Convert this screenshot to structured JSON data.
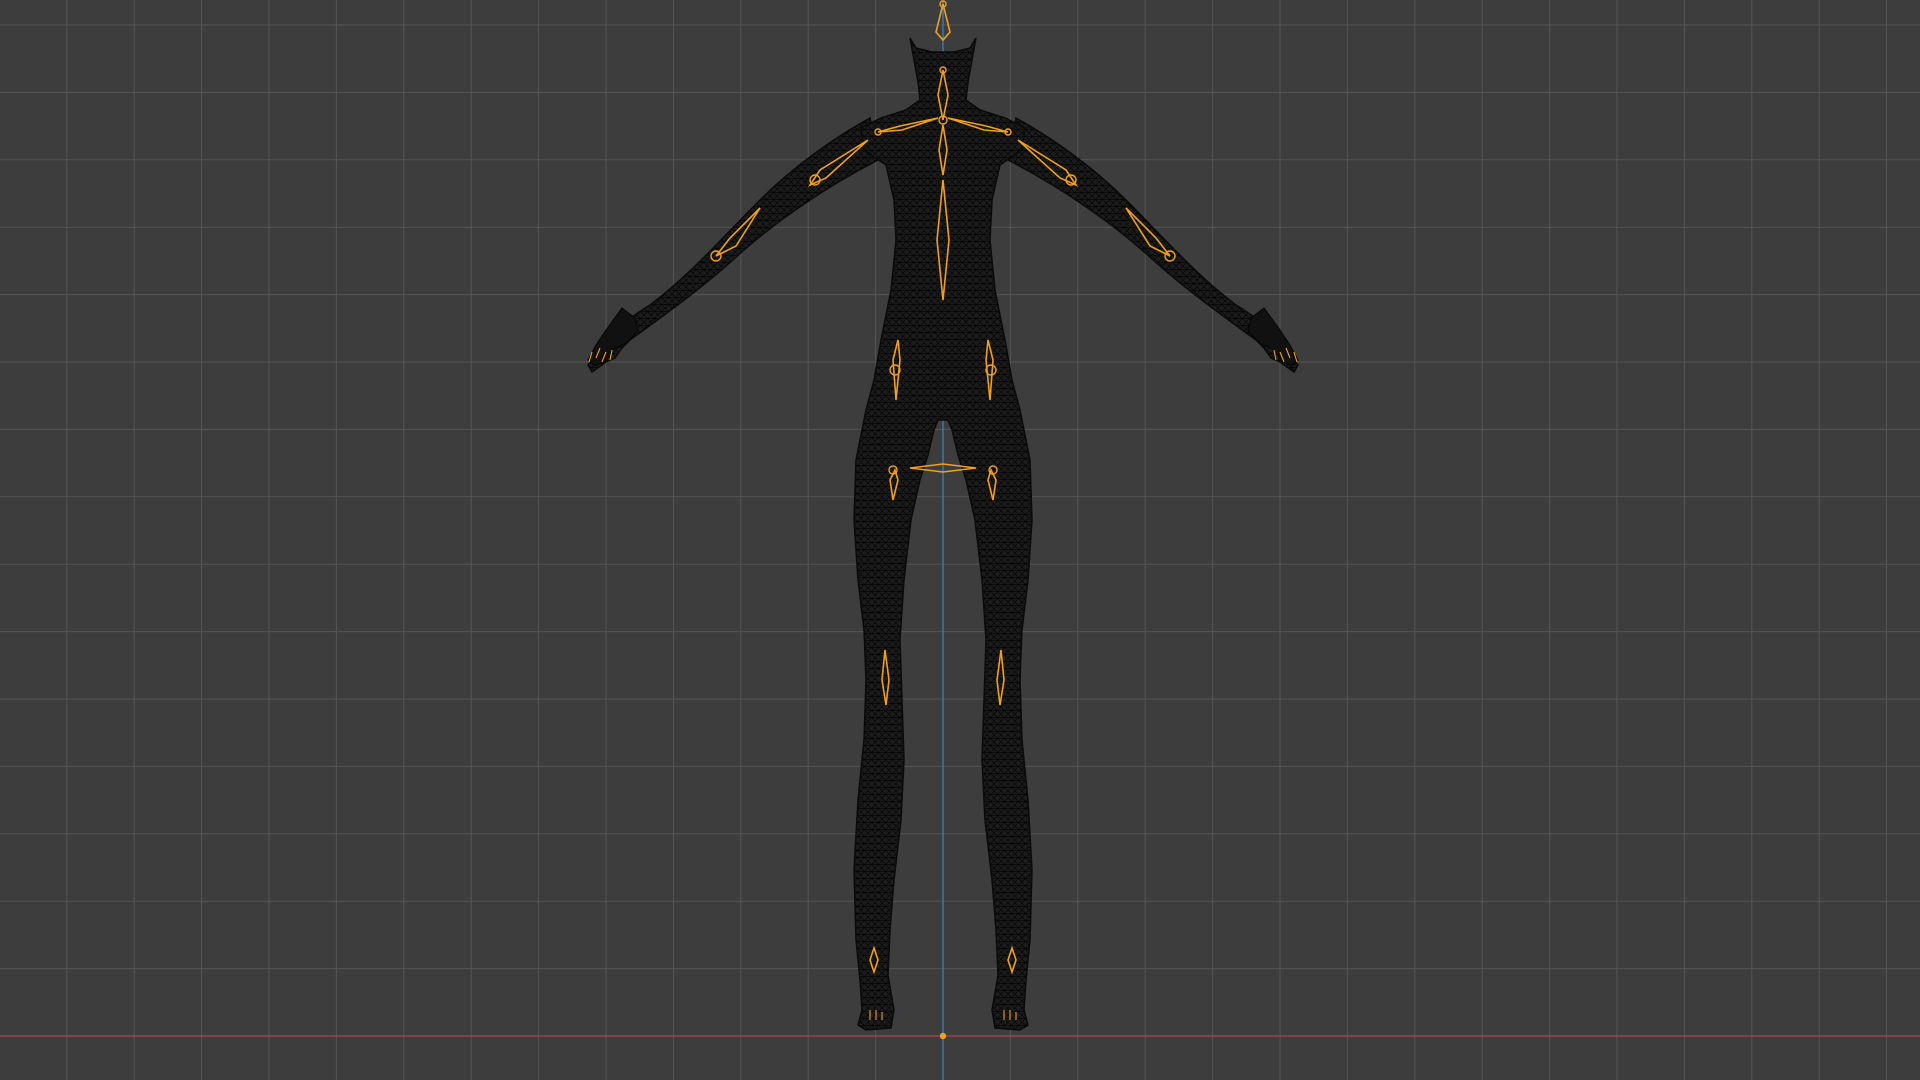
{
  "viewport": {
    "mode": "front-orthographic",
    "shading": "wireframe",
    "colors": {
      "background": "#3d3d3d",
      "grid_minor": "#474747",
      "grid_major": "#555555",
      "x_axis": "#a8454f",
      "z_axis": "#3f7fb0",
      "mesh_fill": "#1b1b1b",
      "mesh_wire": "#0a0a0a",
      "armature": "#f0a020"
    }
  },
  "scene": {
    "object": "character-mesh",
    "rig": "armature",
    "pose": "a-pose"
  }
}
